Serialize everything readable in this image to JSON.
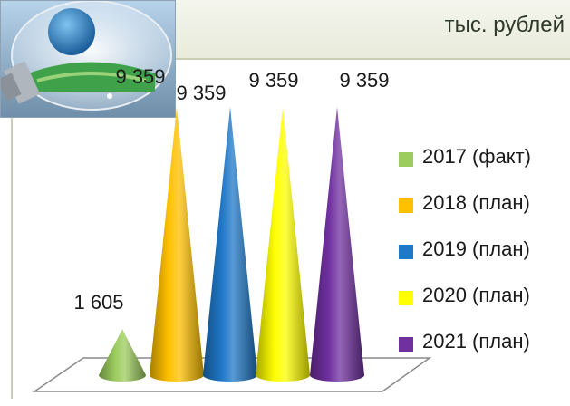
{
  "header": {
    "unit_label": "тыс. рублей"
  },
  "image": {
    "icon": "lightbulb-globe-icon"
  },
  "chart_data": {
    "type": "bar",
    "style": "3d-cone",
    "title": "",
    "xlabel": "",
    "ylabel": "тыс. рублей",
    "categories": [
      "2017 (факт)",
      "2018 (план)",
      "2019 (план)",
      "2020 (план)",
      "2021 (план)"
    ],
    "values": [
      1605,
      9359,
      9359,
      9359,
      9359
    ],
    "value_labels": [
      "1 605",
      "9 359",
      "9 359",
      "9 359",
      "9 359"
    ],
    "colors": [
      "#9ccc5e",
      "#ffc000",
      "#1f78c8",
      "#ffff00",
      "#7030a0"
    ],
    "legend_position": "right",
    "grid": false
  }
}
